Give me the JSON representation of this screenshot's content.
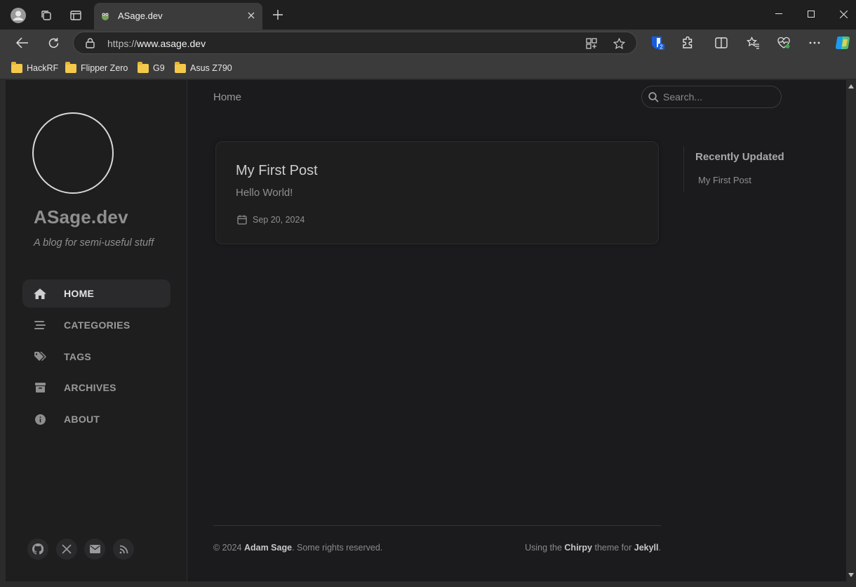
{
  "browser": {
    "tab_title": "ASage.dev",
    "url_prefix": "https://",
    "url_host": "www.asage.dev",
    "extension_badge": "2",
    "bookmarks": [
      "HackRF",
      "Flipper Zero",
      "G9",
      "Asus Z790"
    ]
  },
  "site": {
    "title": "ASage.dev",
    "subtitle": "A blog for semi-useful stuff",
    "nav": [
      {
        "label": "HOME",
        "icon": "home-icon",
        "active": true
      },
      {
        "label": "CATEGORIES",
        "icon": "stream-icon",
        "active": false
      },
      {
        "label": "TAGS",
        "icon": "tags-icon",
        "active": false
      },
      {
        "label": "ARCHIVES",
        "icon": "archive-icon",
        "active": false
      },
      {
        "label": "ABOUT",
        "icon": "info-icon",
        "active": false
      }
    ],
    "social": [
      "github-icon",
      "x-icon",
      "email-icon",
      "rss-icon"
    ]
  },
  "topbar": {
    "breadcrumb": "Home",
    "search_placeholder": "Search..."
  },
  "post": {
    "title": "My First Post",
    "excerpt": "Hello World!",
    "date": "Sep 20, 2024"
  },
  "panel": {
    "heading": "Recently Updated",
    "items": [
      "My First Post"
    ]
  },
  "footer": {
    "left_prefix": "© 2024 ",
    "left_author": "Adam Sage",
    "left_suffix": ". Some rights reserved.",
    "right_prefix": "Using the ",
    "right_theme": "Chirpy",
    "right_mid": " theme for ",
    "right_engine": "Jekyll",
    "right_suffix": "."
  }
}
